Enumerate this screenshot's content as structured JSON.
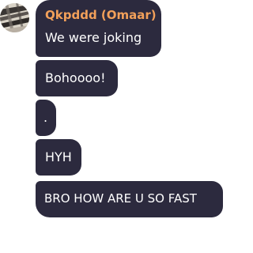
{
  "conversation": {
    "sender_name": "Qkpddd (Omaar)",
    "messages": [
      {
        "text": "We were joking"
      },
      {
        "text": "Bohoooo!"
      },
      {
        "text": "."
      },
      {
        "text": "HYH"
      },
      {
        "text": "BRO HOW ARE U SO FAST"
      }
    ]
  },
  "colors": {
    "bubble_bg": "#2c2a3e",
    "sender_name": "#f2a05a",
    "message_text": "#ffffff"
  },
  "icons": {
    "avatar": "user-avatar-icon"
  }
}
